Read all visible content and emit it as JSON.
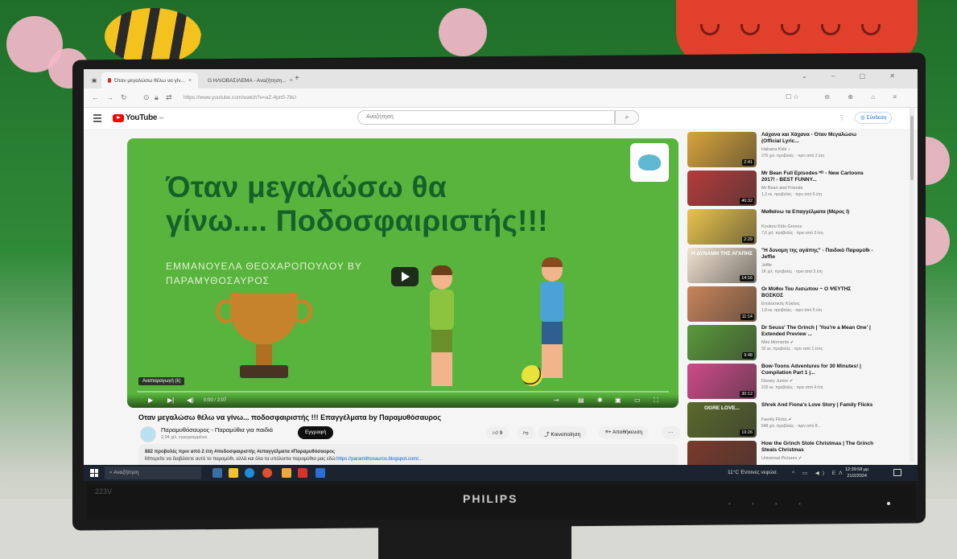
{
  "browser": {
    "tabs": [
      {
        "label": "Όταν μεγαλώσω θέλω να γίν...",
        "close": "×"
      },
      {
        "label": "G  ΗΛΙΟΒΑΣΙΛΕΜΑ - Αναζήτηση...",
        "close": "×"
      }
    ],
    "new_tab": "+",
    "url": "https://www.youtube.com/watch?v=aZ-4pn5-7bU"
  },
  "youtube": {
    "logo": "YouTube",
    "logo_sup": "GR",
    "search_placeholder": "Αναζήτηση",
    "sign_in": "Σύνδεση"
  },
  "player": {
    "title_line1": "Όταν μεγαλώσω θα",
    "title_line2": "γίνω.... Ποδοσφαιριστής!!!",
    "author_line1": "ΕΜΜΑΝΟΥΕΛΑ ΘΕΟΧΑΡΟΠΟΥΛΟΥ ΒΥ",
    "author_line2": "ΠΑΡΑΜΥΘΟΣΑΥΡΟΣ",
    "tooltip": "Αναπαραγωγή (k)",
    "time": "0:00 / 2:07",
    "progress": 0
  },
  "video": {
    "title": "Οταν μεγαλώσω θέλω να γίνω... ποδοσφαιριστής !!! Επαγγέλματα by Παραμυθόσαυρος",
    "channel": "Παραμυθόσαυρος - Παραμύθια για παιδιά",
    "subscribers": "2,94 χιλ. εγγεγραμμένοι",
    "subscribe": "Εγγραφή",
    "likes": "9",
    "share": "Κοινοποίηση",
    "save": "Αποθήκευση",
    "more": "···",
    "desc_meta": "882 προβολές  πριν από 2 έτη  #ποδοσφαιριστής #επαγγέλματα #Παραμυθόσαυρος",
    "desc_text": "Μπορείτε να διαβάσετε αυτό το παραμύθι, αλλά και όλα τα υπόλοιπα παραμύθια μας εδώ:",
    "desc_link": "https://paramithosauros.blogspot.com/..."
  },
  "recommendations": [
    {
      "title": "Λάχανα και Χάχανα - Όταν Μεγαλώσω (Official Lyric...",
      "channel": "Hahana Kids ♪",
      "meta": "276 χιλ. προβολές · πριν από 2 έτη",
      "duration": "2:41",
      "color": "#d8a43a"
    },
    {
      "title": "Mr Bean Full Episodes ᴴᴰ - New Cartoons 2017! - BEST FUNNY...",
      "channel": "Mr Bean and Friends",
      "meta": "1,2 εκ. προβολές · πριν από 6 έτη",
      "duration": "40:32",
      "color": "#b53b3b"
    },
    {
      "title": "Μαθαίνω τα Επαγγέλματα (Μέρος Ι)",
      "channel": "Koukou Kids Greece",
      "meta": "7,6 χιλ. προβολές · πριν από 3 έτη",
      "duration": "2:29",
      "color": "#e8c34a"
    },
    {
      "title": "\"Η δυναμη της αγάπης\" - Παιδικό Παραμύθι - Jeffie",
      "channel": "Jeffie",
      "meta": "1Κ χιλ. προβολές · πριν από 3 έτη",
      "duration": "14:16",
      "color": "#f0e2cf",
      "thumb_text": "Η ΔΥΝΑΜΗ ΤΗΣ ΑΓΑΠΗΣ"
    },
    {
      "title": "Οι Μύθοι Του Αισώπου ~ Ο ΨΕΥΤΗΣ ΒΟΣΚΟΣ",
      "channel": "Επιλεκτικός Κύκλος",
      "meta": "1,8 εκ. προβολές · πριν από 5 έτη",
      "duration": "11:14",
      "color": "#c9855a"
    },
    {
      "title": "Dr Seuss' The Grinch | 'You're a Mean One' | Extended Preview ...",
      "channel": "Mini Moments ✔",
      "meta": "92 εκ. προβολές · πριν από 1 έτος",
      "duration": "9:48",
      "color": "#5a9a3a"
    },
    {
      "title": "Bow-Toons Adventures for 30 Minutes! | Compilation Part 1 |...",
      "channel": "Disney Junior ✔",
      "meta": "215 εκ. προβολές · πριν από 4 έτη",
      "duration": "30:12",
      "color": "#d04a8a"
    },
    {
      "title": "Shrek And Fiona's Love Story | Family Flicks",
      "channel": "Family Flicks ✔",
      "meta": "548 χιλ. προβολές · πριν από 8...",
      "duration": "19:26",
      "color": "#5a6a2a",
      "thumb_text": "OGRE LOVE..."
    },
    {
      "title": "How the Grinch Stole Christmas | The Grinch Steals Christmas",
      "channel": "Universal Pictures ✔",
      "meta": "",
      "duration": "",
      "color": "#7a3a2a"
    }
  ],
  "taskbar": {
    "search": "Αναζήτηση",
    "weather": "11°C  Έντονες νεφώσ.",
    "tray": "ΕΛ",
    "time": "12:39:58 μμ",
    "date": "21/2/2024"
  },
  "monitor": {
    "brand": "PHILIPS",
    "model": "223V"
  }
}
